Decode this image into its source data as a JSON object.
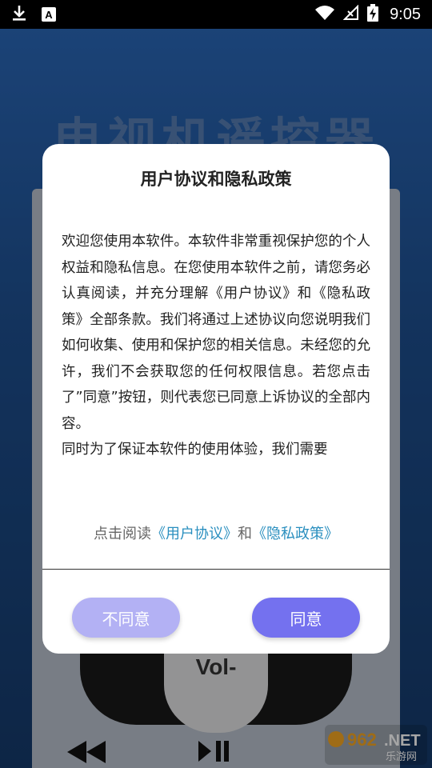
{
  "status_bar": {
    "time": "9:05",
    "icons": [
      "download-icon",
      "a-notification-icon",
      "wifi-icon",
      "no-signal-icon",
      "battery-charging-icon"
    ]
  },
  "background": {
    "app_title": "电视机遥控器",
    "vol_label": "Vol-",
    "watermark_text": "962.NET 乐游网"
  },
  "dialog": {
    "title": "用户协议和隐私政策",
    "paragraphs": [
      "欢迎您使用本软件。本软件非常重视保护您的个人权益和隐私信息。在您使用本软件之前，请您务必认真阅读，并充分理解《用户协议》和《隐私政策》全部条款。我们将通过上述协议向您说明我们如何收集、使用和保护您的相关信息。未经您的允许，我们不会获取您的任何权限信息。若您点击了”同意”按钮，则代表您已同意上诉协议的全部内容。",
      "同时为了保证本软件的使用体验，我们需要"
    ],
    "links_prefix": "点击阅读",
    "link_user_agreement": "《用户协议》",
    "links_and": "和",
    "link_privacy_policy": "《隐私政策》",
    "disagree_label": "不同意",
    "agree_label": "同意"
  },
  "colors": {
    "agree": "#7471ef",
    "disagree": "#b3b1f4",
    "link": "#2a8fbf"
  }
}
